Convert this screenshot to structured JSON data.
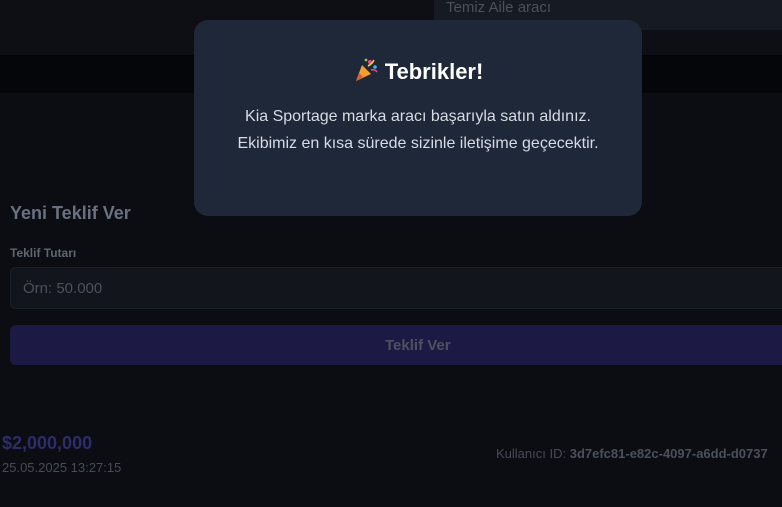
{
  "header": {
    "description_value": "Temiz Aile aracı"
  },
  "offer_form": {
    "title": "Yeni Teklif Ver",
    "amount_label": "Teklif Tutarı",
    "amount_placeholder": "Örn: 50.000",
    "submit_label": "Teklif Ver"
  },
  "offer": {
    "amount": "$2,000,000",
    "datetime": "25.05.2025 13:27:15",
    "user_label": "Kullanıcı ID:",
    "user_id": "3d7efc81-e82c-4097-a6dd-d0737"
  },
  "modal": {
    "icon": "party-popper-icon",
    "title": "Tebrikler!",
    "message": "Kia Sportage marka aracı başarıyla satın aldınız. Ekibimiz en kısa sürede sizinle iletişime geçecektir."
  },
  "colors": {
    "modal_bg": "#1f2838",
    "page_bg": "#0b0d12",
    "button_bg": "#1c1a45"
  }
}
